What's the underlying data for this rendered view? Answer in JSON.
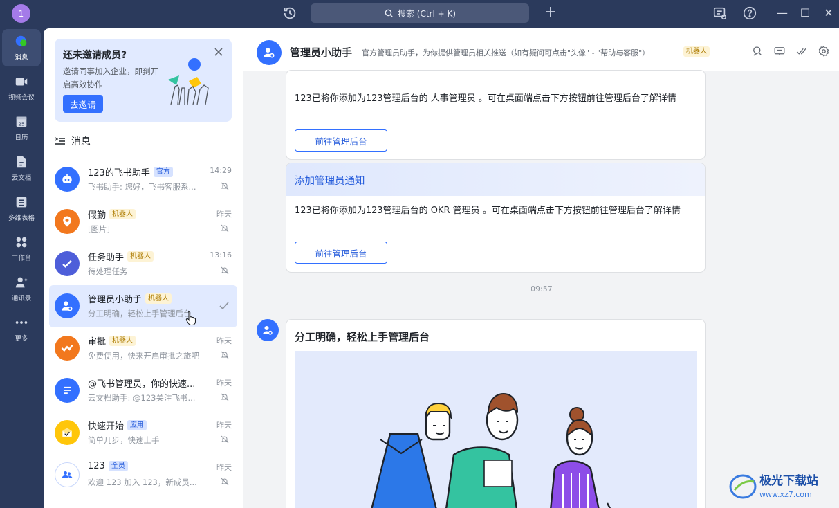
{
  "topbar": {
    "user_initial": "1",
    "search_label": "搜索 (Ctrl + K)"
  },
  "nav": [
    {
      "label": "消息",
      "icon": "message-icon",
      "active": true
    },
    {
      "label": "视频会议",
      "icon": "video-icon",
      "active": false
    },
    {
      "label": "日历",
      "icon": "calendar-icon",
      "active": false,
      "day": "25"
    },
    {
      "label": "云文档",
      "icon": "doc-icon",
      "active": false
    },
    {
      "label": "多维表格",
      "icon": "table-icon",
      "active": false
    },
    {
      "label": "工作台",
      "icon": "apps-icon",
      "active": false
    },
    {
      "label": "通讯录",
      "icon": "contacts-icon",
      "active": false
    },
    {
      "label": "更多",
      "icon": "more-icon",
      "active": false
    }
  ],
  "invite": {
    "title": "还未邀请成员?",
    "desc": "邀请同事加入企业，即刻开启高效协作",
    "button": "去邀请"
  },
  "section_title": "消息",
  "conversations": [
    {
      "name": "123的飞书助手",
      "tag": "官方",
      "tag_type": "official",
      "preview": "飞书助手: 您好，飞书客服系...",
      "time": "14:29",
      "color": "#3370ff",
      "icon": "robot-icon",
      "muted": true
    },
    {
      "name": "假勤",
      "tag": "机器人",
      "tag_type": "bot",
      "preview": "[图片]",
      "time": "昨天",
      "color": "#f2781e",
      "icon": "location-icon",
      "muted": true
    },
    {
      "name": "任务助手",
      "tag": "机器人",
      "tag_type": "bot",
      "preview": "待处理任务",
      "time": "13:16",
      "color": "#4e5ed9",
      "icon": "task-check-icon",
      "muted": true
    },
    {
      "name": "管理员小助手",
      "tag": "机器人",
      "tag_type": "bot",
      "preview": "分工明确，轻松上手管理后台",
      "time": "",
      "color": "#3370ff",
      "icon": "admin-user-icon",
      "muted": false,
      "active": true
    },
    {
      "name": "审批",
      "tag": "机器人",
      "tag_type": "bot",
      "preview": "免费使用，快来开启审批之旅吧",
      "time": "昨天",
      "color": "#f2781e",
      "icon": "approval-icon",
      "muted": true
    },
    {
      "name": "@飞书管理员，你的快速...",
      "tag": "",
      "tag_type": "",
      "preview": "云文档助手: @123关注飞书...",
      "time": "昨天",
      "color": "#3370ff",
      "icon": "doc-lines-icon",
      "muted": true
    },
    {
      "name": "快速开始",
      "tag": "应用",
      "tag_type": "official",
      "preview": "简单几步，快速上手",
      "time": "昨天",
      "color": "#ffc60a",
      "icon": "quickstart-icon",
      "muted": true
    },
    {
      "name": "123",
      "tag": "全员",
      "tag_type": "official",
      "preview": "欢迎 123 加入 123，新成员...",
      "time": "昨天",
      "color": "#ffffff",
      "icon": "group-icon",
      "muted": true
    }
  ],
  "chat": {
    "title": "管理员小助手",
    "subtitle": "官方管理员助手，为你提供管理员相关推送（如有疑问可点击\"头像\" - \"帮助与客服\"）",
    "tag": "机器人",
    "card1": {
      "text": "123已将你添加为123管理后台的 人事管理员 。可在桌面端点击下方按钮前往管理后台了解详情",
      "button": "前往管理后台"
    },
    "card2": {
      "head": "添加管理员通知",
      "text": "123已将你添加为123管理后台的 OKR 管理员 。可在桌面端点击下方按钮前往管理后台了解详情",
      "button": "前往管理后台"
    },
    "timestamp": "09:57",
    "card3": {
      "title": "分工明确，轻松上手管理后台"
    }
  },
  "watermark": {
    "title": "极光下载站",
    "url": "www.xz7.com"
  }
}
